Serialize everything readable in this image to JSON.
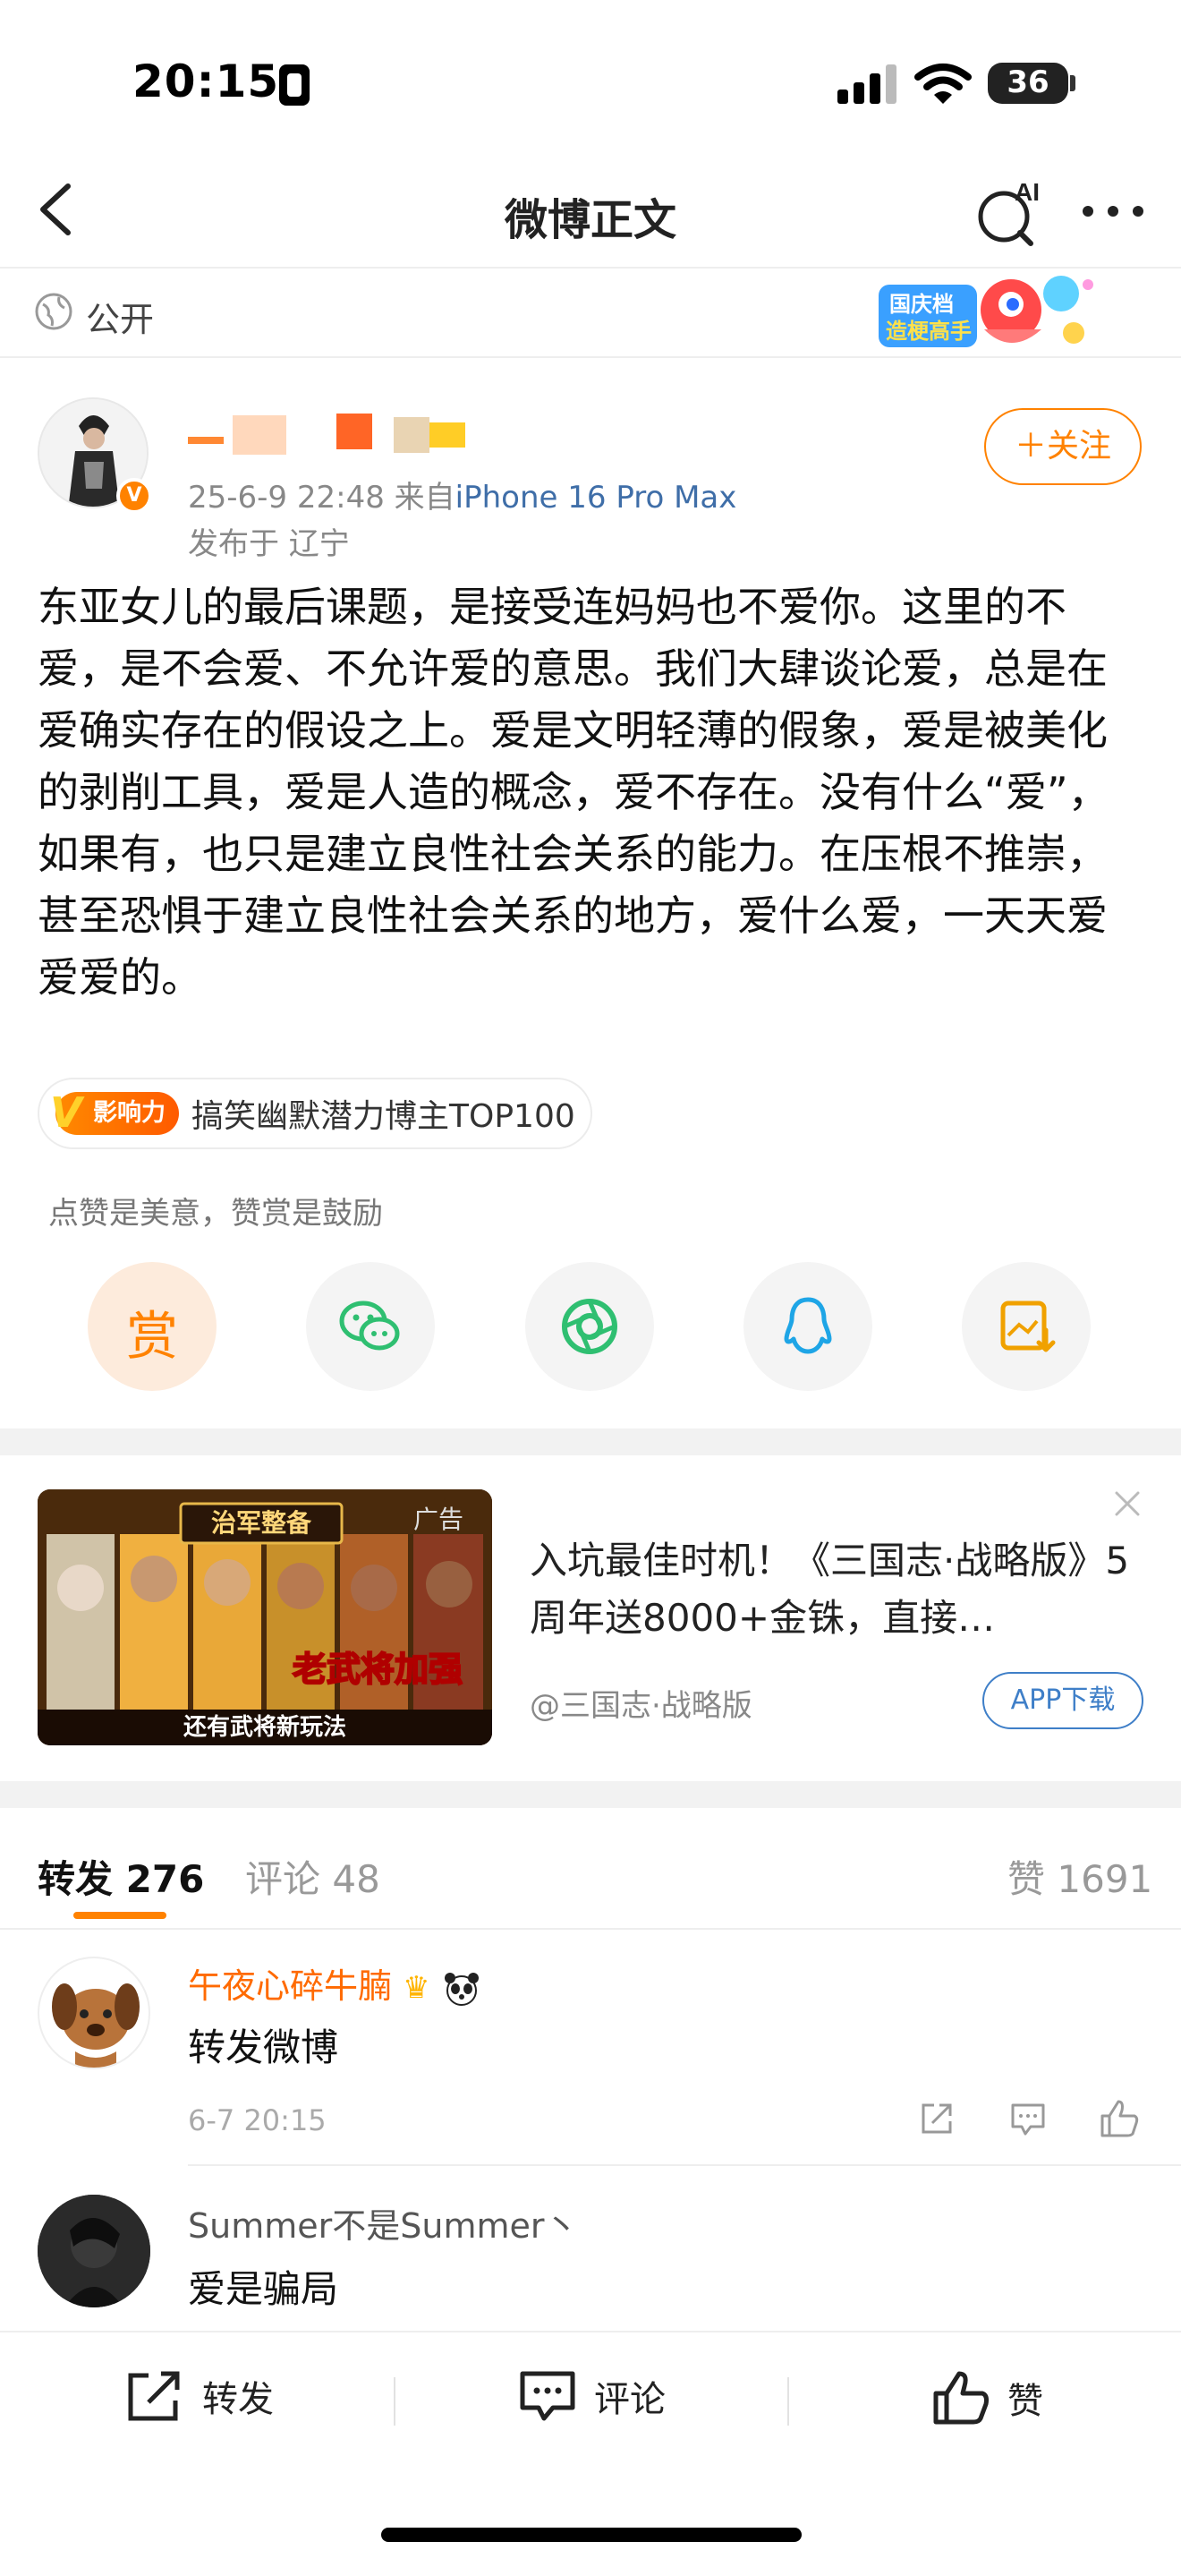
{
  "status_bar": {
    "time": "20:15",
    "battery": "36"
  },
  "nav": {
    "title": "微博正文",
    "ai_label": "AI"
  },
  "visibility": {
    "label": "公开"
  },
  "author": {
    "meta_date": "25-6-9 22:48",
    "meta_from": "来自",
    "device": "iPhone 16 Pro Max",
    "location": "发布于 辽宁",
    "follow_label": "＋关注"
  },
  "post": {
    "text": "东亚女儿的最后课题，是接受连妈妈也不爱你。这里的不爱，是不会爱、不允许爱的意思。我们大肆谈论爱，总是在爱确实存在的假设之上。爱是文明轻薄的假象，爱是被美化的剥削工具，爱是人造的概念，爱不存在。没有什么“爱”，如果有，也只是建立良性社会关系的能力。在压根不推崇，甚至恐惧于建立良性社会关系的地方，爱什么爱，一天天爱爱爱的。"
  },
  "influence": {
    "badge": "影响力",
    "text": "搞笑幽默潜力博主TOP100"
  },
  "reward": {
    "hint": "点赞是美意，赞赏是鼓励",
    "button": "赏"
  },
  "share_icons": [
    "reward-icon",
    "wechat-icon",
    "moments-icon",
    "qq-icon",
    "save-image-icon"
  ],
  "ad": {
    "tag": "广告",
    "title": "入坑最佳时机！《三国志·战略版》5周年送8000+金铢，直接…",
    "source": "@三国志·战略版",
    "download": "APP下载",
    "image_caption_top": "治军整备",
    "image_caption_mid": "老武将加强",
    "image_caption_bottom": "还有武将新玩法"
  },
  "tabs": {
    "repost_label": "转发",
    "repost_count": "276",
    "comment_label": "评论",
    "comment_count": "48",
    "like_label": "赞",
    "like_count": "1691"
  },
  "reposts": [
    {
      "name": "午夜心碎牛腩",
      "body": "转发微博",
      "time": "6-7 20:15"
    },
    {
      "name": "Summer不是Summer丶",
      "body": "爱是骗局"
    }
  ],
  "bottom_bar": {
    "repost": "转发",
    "comment": "评论",
    "like": "赞"
  },
  "colors": {
    "accent": "#ff8200",
    "link": "#3f6ea8"
  }
}
